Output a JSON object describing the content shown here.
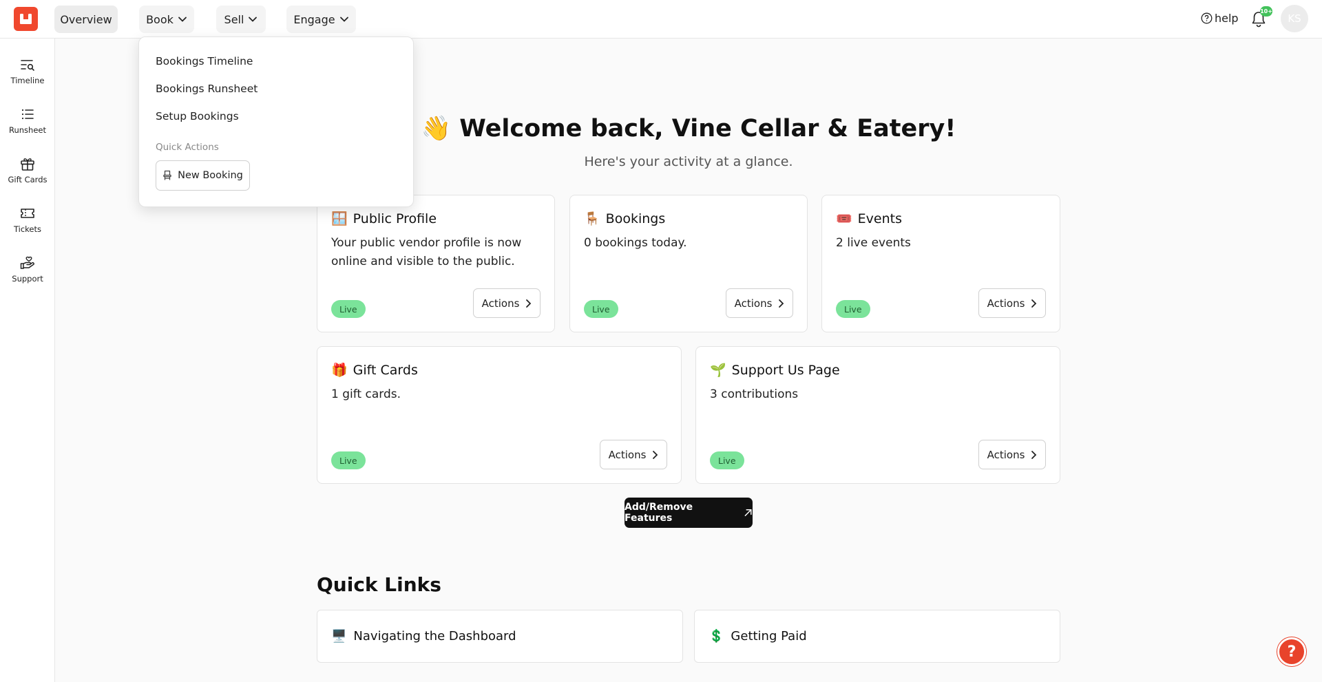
{
  "topbar": {
    "nav": {
      "overview": "Overview",
      "book": "Book",
      "sell": "Sell",
      "engage": "Engage"
    },
    "help": "help",
    "notifications_badge": "10+",
    "avatar_initials": "KS"
  },
  "sidebar": {
    "items": [
      {
        "label": "Timeline",
        "icon": "timeline-search-icon"
      },
      {
        "label": "Runsheet",
        "icon": "list-icon"
      },
      {
        "label": "Gift Cards",
        "icon": "gift-icon"
      },
      {
        "label": "Tickets",
        "icon": "ticket-icon"
      },
      {
        "label": "Support",
        "icon": "hand-heart-icon"
      }
    ]
  },
  "book_menu": {
    "items": [
      "Bookings Timeline",
      "Bookings Runsheet",
      "Setup Bookings"
    ],
    "quick_actions_label": "Quick Actions",
    "new_booking": "New Booking"
  },
  "main": {
    "welcome_emoji": "👋",
    "welcome": "Welcome back, Vine Cellar & Eatery!",
    "subtitle": "Here's your activity at a glance.",
    "cards": [
      {
        "emoji": "🪟",
        "title": "Public Profile",
        "desc": "Your public vendor profile is now online and visible to the public.",
        "status": "Live",
        "action": "Actions"
      },
      {
        "emoji": "🪑",
        "title": "Bookings",
        "desc": "0 bookings today.",
        "status": "Live",
        "action": "Actions"
      },
      {
        "emoji": "🎟️",
        "title": "Events",
        "desc": "2 live events",
        "status": "Live",
        "action": "Actions"
      },
      {
        "emoji": "🎁",
        "title": "Gift Cards",
        "desc": "1 gift cards.",
        "status": "Live",
        "action": "Actions"
      },
      {
        "emoji": "🌱",
        "title": "Support Us Page",
        "desc": "3 contributions",
        "status": "Live",
        "action": "Actions"
      }
    ],
    "add_remove": "Add/Remove Features",
    "quick_links_title": "Quick Links",
    "quick_links": [
      {
        "emoji": "🖥️",
        "label": "Navigating the Dashboard"
      },
      {
        "emoji": "💲",
        "label": "Getting Paid"
      }
    ],
    "help_fab": "?"
  },
  "colors": {
    "brand": "#f0482e",
    "live_badge": "#7be39a",
    "notification_badge": "#43c25b"
  }
}
